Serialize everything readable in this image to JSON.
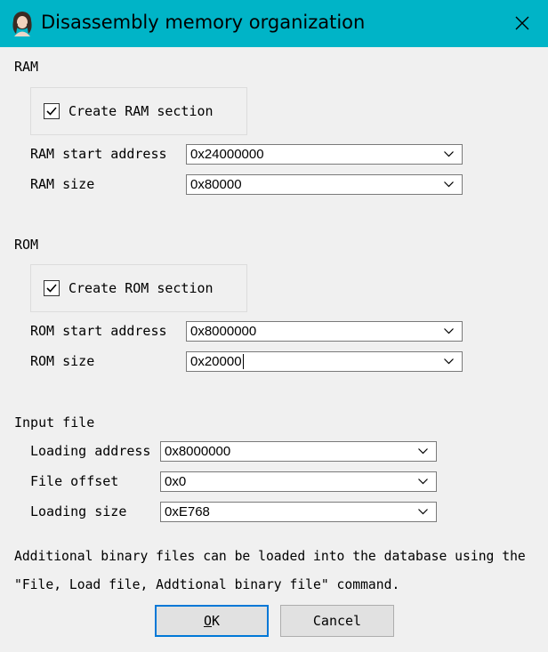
{
  "window": {
    "title": "Disassembly memory organization",
    "icon": "avatar-portrait-icon"
  },
  "ram": {
    "group_label": "RAM",
    "create_label": "Create RAM section",
    "create_checked": true,
    "start_label": "RAM start address",
    "start_value": "0x24000000",
    "size_label": "RAM size",
    "size_value": "0x80000"
  },
  "rom": {
    "group_label": "ROM",
    "create_label": "Create ROM section",
    "create_checked": true,
    "start_label": "ROM start address",
    "start_value": "0x8000000",
    "size_label": "ROM size",
    "size_value": "0x20000"
  },
  "input_file": {
    "group_label": "Input file",
    "loading_address_label": "Loading address",
    "loading_address_value": "0x8000000",
    "file_offset_label": "File offset",
    "file_offset_value": "0x0",
    "loading_size_label": "Loading size",
    "loading_size_value": "0xE768"
  },
  "info": {
    "line1": "Additional binary files can be loaded into the database using the",
    "line2": "\"File, Load file, Addtional binary file\" command."
  },
  "buttons": {
    "ok_underlined": "O",
    "ok_rest": "K",
    "cancel": "Cancel"
  },
  "colors": {
    "titlebar": "#00b4c7",
    "default_button_border": "#0078d7"
  }
}
